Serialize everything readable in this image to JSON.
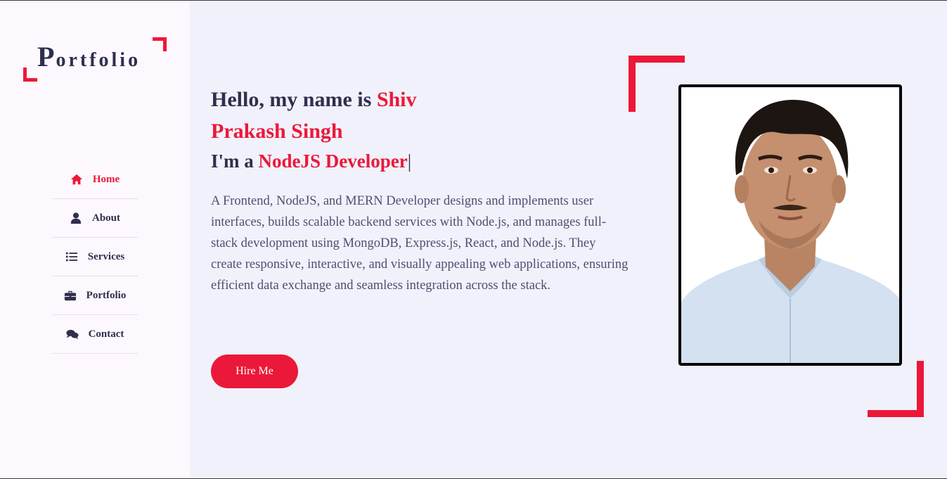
{
  "logo": {
    "first_letter": "P",
    "rest": "ortfolio"
  },
  "nav": [
    {
      "label": "Home",
      "icon": "home-icon",
      "active": true
    },
    {
      "label": "About",
      "icon": "user-icon",
      "active": false
    },
    {
      "label": "Services",
      "icon": "list-icon",
      "active": false
    },
    {
      "label": "Portfolio",
      "icon": "briefcase-icon",
      "active": false
    },
    {
      "label": "Contact",
      "icon": "comments-icon",
      "active": false
    }
  ],
  "hero": {
    "greeting": "Hello, my name is ",
    "name_part1": "Shiv",
    "name_part2": "Prakash Singh",
    "role_prefix": "I'm a ",
    "role": "NodeJS Developer",
    "cursor": "|",
    "description": "A Frontend, NodeJS, and MERN Developer designs and implements user interfaces, builds scalable backend services with Node.js, and manages full-stack development using MongoDB, Express.js, React, and Node.js. They create responsive, interactive, and visually appealing web applications, ensuring efficient data exchange and seamless integration across the stack.",
    "hire_label": "Hire Me"
  },
  "colors": {
    "accent": "#ec1839",
    "text_dark": "#302e4d",
    "text_body": "#504e70",
    "sidebar_bg": "#fcf8fd",
    "main_bg": "#f1f1fb"
  }
}
